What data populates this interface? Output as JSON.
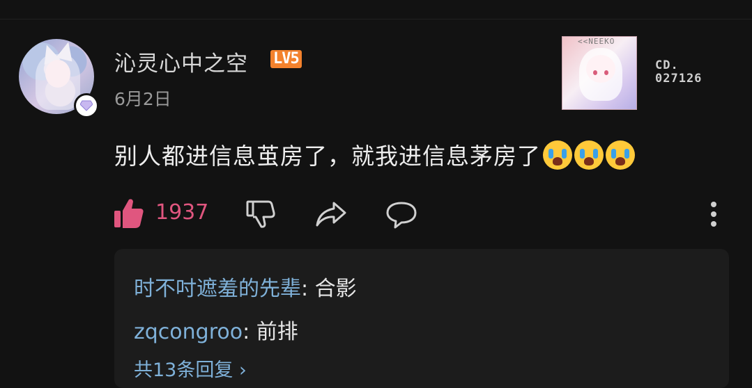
{
  "comment": {
    "username": "沁灵心中之空",
    "level": "LV5",
    "date": "6月2日",
    "decoration_code": [
      "CD.",
      "027126"
    ],
    "decoration_label": "<<NEEKO",
    "text": "别人都进信息茧房了，就我进信息茅房了",
    "emojis": [
      "crying-face",
      "crying-face",
      "crying-face"
    ],
    "like_count": "1937",
    "like_color": "#e0567f"
  },
  "replies": [
    {
      "author": "时不吋遮羞的先辈",
      "sep": ": ",
      "text": "合影"
    },
    {
      "author": "zqcongroo",
      "sep": ": ",
      "text": "前排"
    }
  ],
  "more_replies": "共13条回复 ›",
  "colors": {
    "background": "#121212",
    "reply_box": "#1c1c1c",
    "link_blue": "#7fb1d9",
    "level_badge": "#f3822d"
  }
}
